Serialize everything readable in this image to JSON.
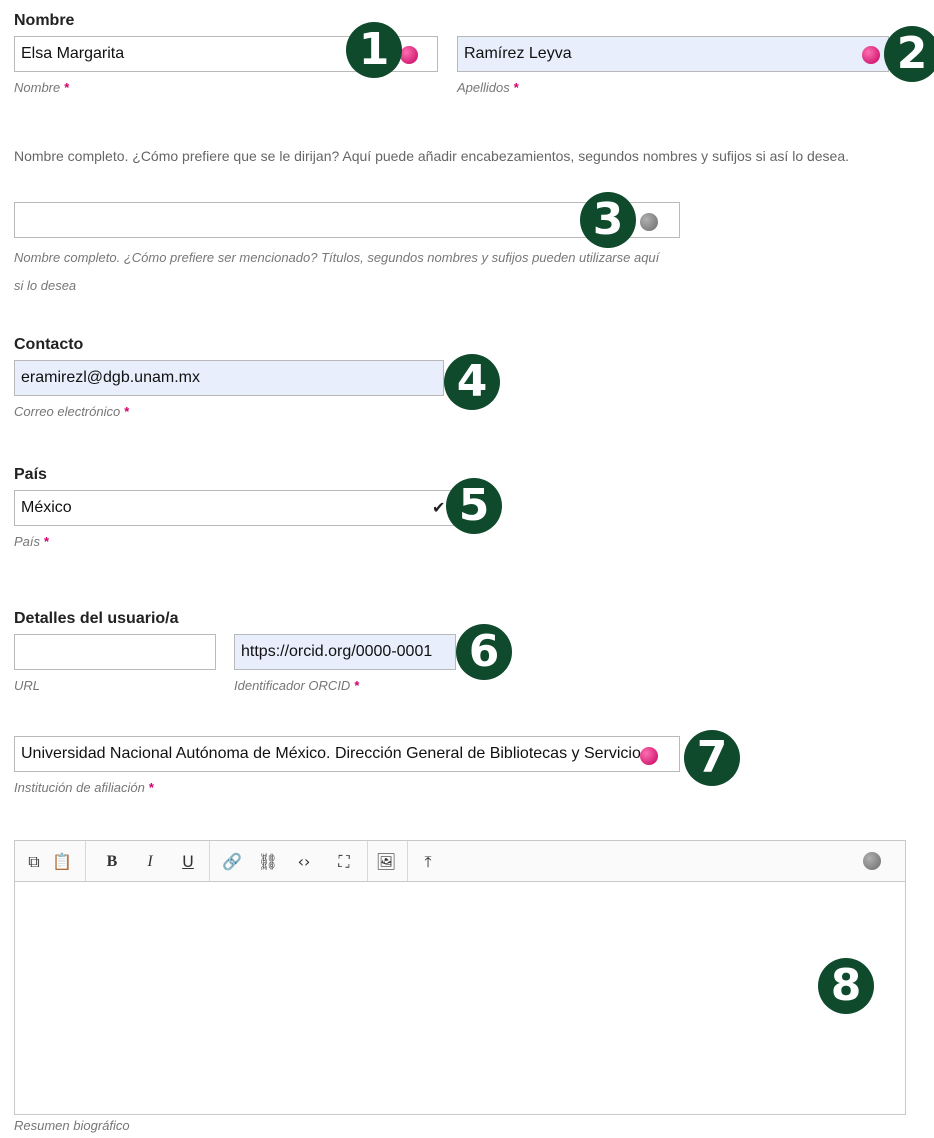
{
  "name_section": {
    "title": "Nombre",
    "given_name": {
      "value": "Elsa Margarita",
      "label": "Nombre"
    },
    "family_name": {
      "value": "Ramírez Leyva",
      "label": "Apellidos"
    },
    "help_text": "Nombre completo. ¿Cómo prefiere que se le dirijan? Aquí puede añadir encabezamientos, segundos nombres y sufijos si así lo desea.",
    "preferred_name": {
      "value": "",
      "label": "Nombre completo. ¿Cómo prefiere ser mencionado? Títulos, segundos nombres y sufijos pueden utilizarse aquí si lo desea"
    }
  },
  "contact_section": {
    "title": "Contacto",
    "email": {
      "value": "eramirezl@dgb.unam.mx",
      "label": "Correo electrónico"
    }
  },
  "country_section": {
    "title": "País",
    "country": {
      "value": "México",
      "label": "País"
    }
  },
  "user_details_section": {
    "title": "Detalles del usuario/a",
    "url": {
      "value": "",
      "label": "URL"
    },
    "orcid": {
      "value": "https://orcid.org/0000-0001",
      "label": "Identificador ORCID"
    },
    "affiliation": {
      "value": "Universidad Nacional Autónoma de México. Dirección General de Bibliotecas y Servicio",
      "label": "Institución de afiliación"
    }
  },
  "bio_section": {
    "label": "Resumen biográfico",
    "toolbar": {
      "copy": "⧉",
      "paste": "📋",
      "bold": "B",
      "italic": "I",
      "underline": "U",
      "link": "🔗",
      "unlink": "⛓",
      "code": "‹›",
      "fullscreen": "⛶",
      "image": "🖼",
      "upload": "⤒"
    },
    "content": ""
  },
  "required_marker": "*",
  "badges": [
    "1",
    "2",
    "3",
    "4",
    "5",
    "6",
    "7",
    "8"
  ],
  "colors": {
    "badge_bg": "#0f4a2c",
    "required": "#d0006f",
    "filled_field_bg": "#e8eefb",
    "globe_active": "#d0006f",
    "globe_inactive": "#808080"
  }
}
